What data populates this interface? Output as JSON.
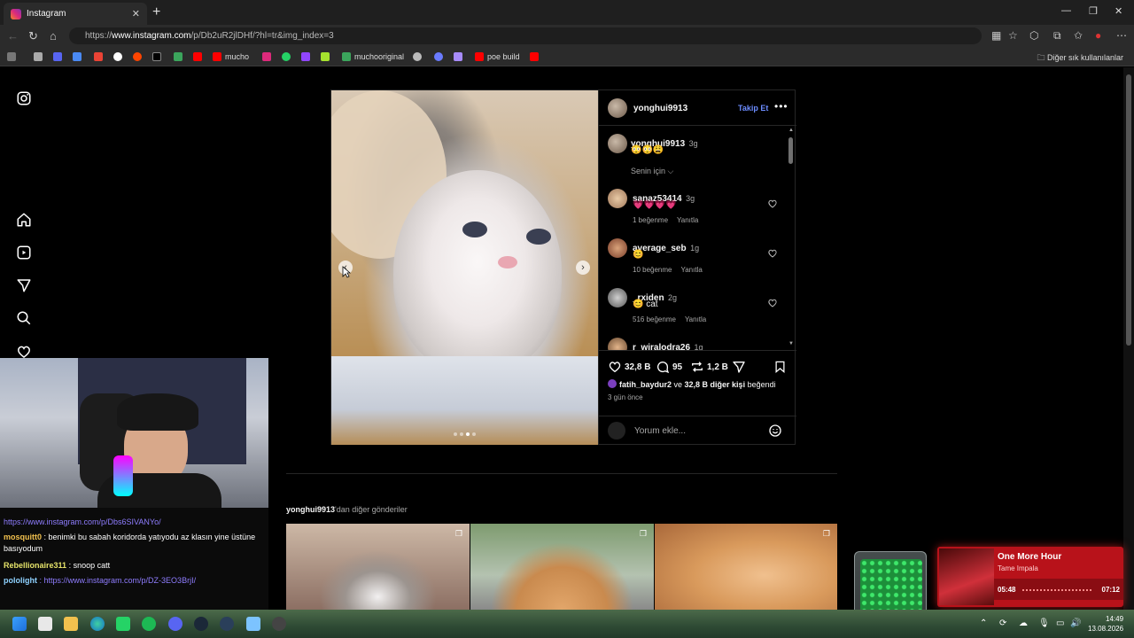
{
  "browser": {
    "tab_title": "Instagram",
    "tab_close": "✕",
    "new_tab": "+",
    "url_prefix": "https://",
    "url_host": "www.instagram.com",
    "url_path": "/p/Db2uR2jlDHf/?hl=tr&img_index=3",
    "bookmarks": [
      "mucho",
      "muchooriginal",
      "poe build"
    ],
    "bookmarks_folder": "Diğer sık kullanılanlar"
  },
  "post": {
    "author": "yonghui9913",
    "follow_label": "Takip Et",
    "caption": {
      "user": "yonghui9913",
      "time": "3g",
      "emoji": "😳😳😩"
    },
    "for_you": "Senin için ⌵",
    "comments": [
      {
        "user": "sanaz53414",
        "time": "3g",
        "text": "💗💗💗💗",
        "likes": "1 beğenme",
        "reply": "Yanıtla"
      },
      {
        "user": "average_seb",
        "time": "1g",
        "text": "😊",
        "likes": "10 beğenme",
        "reply": "Yanıtla"
      },
      {
        "user": "_rxiden",
        "time": "2g",
        "text": "😊 cat",
        "likes": "516 beğenme",
        "reply": "Yanıtla"
      },
      {
        "user": "r_wiralodra26",
        "time": "1g",
        "text": "",
        "likes": "",
        "reply": ""
      }
    ],
    "like_count": "32,8 B",
    "comment_count": "95",
    "repost_count": "1,2 B",
    "liked_by_user": "fatih_baydur2",
    "liked_by_mid": " ve ",
    "liked_by_others": "32,8 B diğer kişi",
    "liked_by_suffix": " beğendi",
    "posted_ago": "3 gün önce",
    "add_comment_placeholder": "Yorum ekle...",
    "carousel_index": 3,
    "carousel_total": 4
  },
  "more_posts": {
    "user": "yonghui9913",
    "suffix": "'dan diğer gönderiler"
  },
  "chat": [
    {
      "user": "",
      "text": "https://www.instagram.com/p/Dbs6SIVANYo/"
    },
    {
      "user": "mosquitt0",
      "text": ": benimki bu sabah koridorda yatıyodu az klasın yine üstüne basıyodum"
    },
    {
      "user": "Rebellionaire311",
      "text": ": snoop catt"
    },
    {
      "user": "pololight",
      "text": ": https://www.instagram.com/p/DZ-3EO3BrjI/"
    }
  ],
  "music": {
    "title": "One More Hour",
    "artist": "Tame Impala",
    "elapsed": "05:48",
    "duration": "07:12"
  },
  "clock": {
    "time": "14:49",
    "date": "13.08.2026"
  },
  "colors": {
    "link_blue": "#6c8cff",
    "chat_link": "#8f7dff",
    "music_red": "#b8121a"
  }
}
